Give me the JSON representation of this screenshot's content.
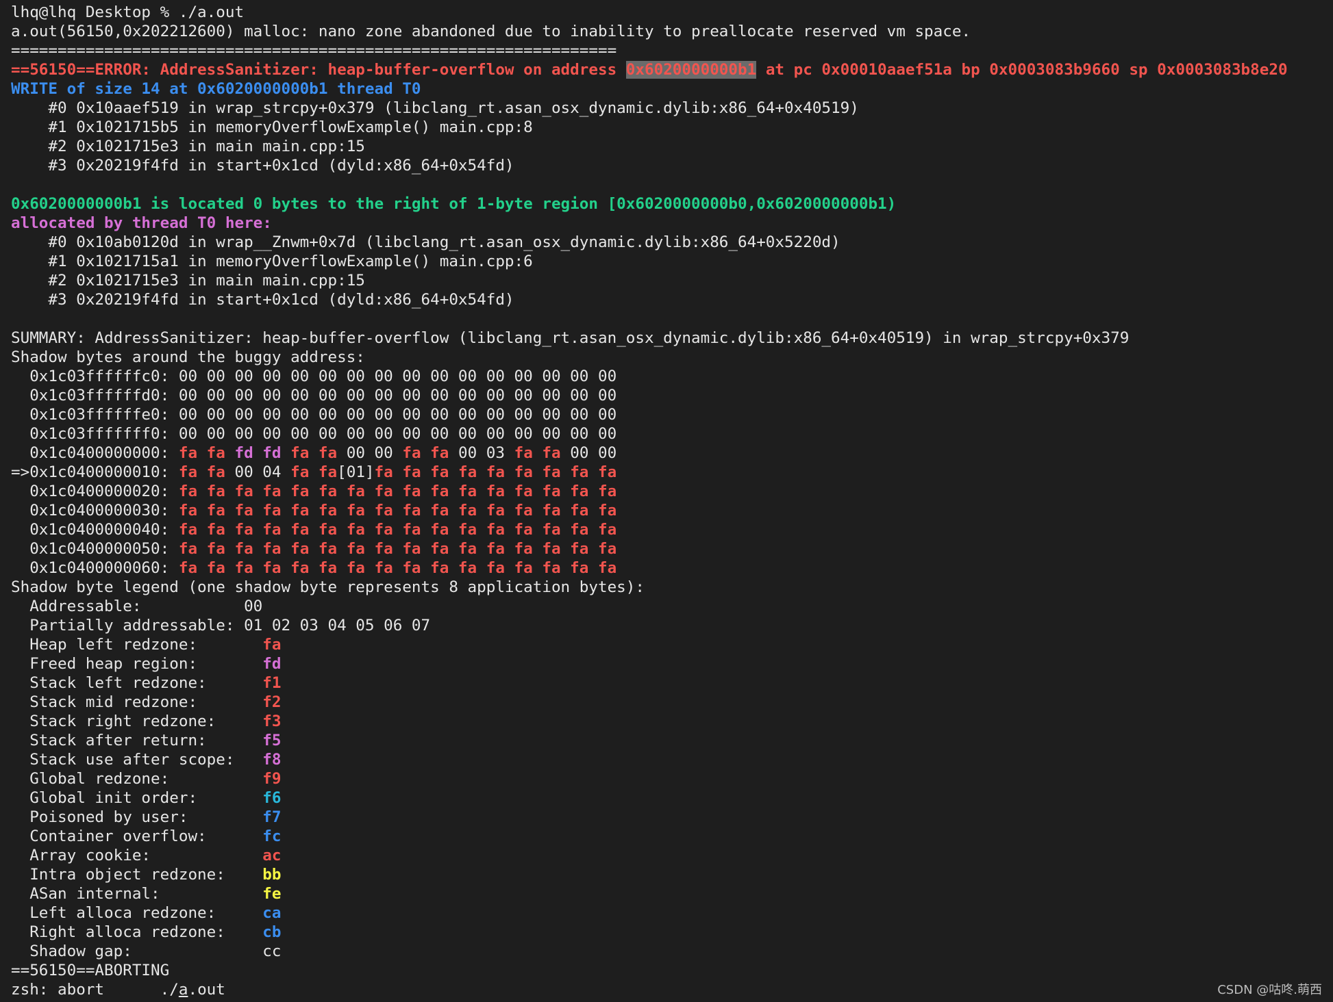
{
  "colors": {
    "background": "#1e1e1e",
    "text": "#e6e6e6",
    "red": "#f2554f",
    "blue": "#3b8ef0",
    "green": "#23d18b",
    "magenta": "#d670d6",
    "cyan": "#29b8db",
    "yellow": "#f5f543"
  },
  "watermark": "CSDN @咕咚.萌西",
  "lines": [
    [
      {
        "t": "lhq@lhq Desktop % ./a.out",
        "c": "plain"
      }
    ],
    [
      {
        "t": "a.out(56150,0x202212600) malloc: nano zone abandoned due to inability to preallocate reserved vm space.",
        "c": "plain"
      }
    ],
    [
      {
        "t": "=================================================================",
        "c": "plain"
      }
    ],
    [
      {
        "t": "==56150==ERROR: AddressSanitizer: heap-buffer-overflow on address ",
        "c": "red"
      },
      {
        "t": "0x6020000000b1",
        "c": "red hl"
      },
      {
        "t": " at pc 0x00010aaef51a bp 0x0003083b9660 sp 0x0003083b8e20",
        "c": "red"
      }
    ],
    [
      {
        "t": "WRITE of size 14 at 0x6020000000b1 thread T0",
        "c": "blue"
      }
    ],
    [
      {
        "t": "    #0 0x10aaef519 in wrap_strcpy+0x379 (libclang_rt.asan_osx_dynamic.dylib:x86_64+0x40519)",
        "c": "plain"
      }
    ],
    [
      {
        "t": "    #1 0x1021715b5 in memoryOverflowExample() main.cpp:8",
        "c": "plain"
      }
    ],
    [
      {
        "t": "    #2 0x1021715e3 in main main.cpp:15",
        "c": "plain"
      }
    ],
    [
      {
        "t": "    #3 0x20219f4fd in start+0x1cd (dyld:x86_64+0x54fd)",
        "c": "plain"
      }
    ],
    [
      {
        "t": "",
        "c": "plain"
      }
    ],
    [
      {
        "t": "0x6020000000b1 is located 0 bytes to the right of 1-byte region [0x6020000000b0,0x6020000000b1)",
        "c": "green"
      }
    ],
    [
      {
        "t": "allocated by thread T0 here:",
        "c": "magenta"
      }
    ],
    [
      {
        "t": "    #0 0x10ab0120d in wrap__Znwm+0x7d (libclang_rt.asan_osx_dynamic.dylib:x86_64+0x5220d)",
        "c": "plain"
      }
    ],
    [
      {
        "t": "    #1 0x1021715a1 in memoryOverflowExample() main.cpp:6",
        "c": "plain"
      }
    ],
    [
      {
        "t": "    #2 0x1021715e3 in main main.cpp:15",
        "c": "plain"
      }
    ],
    [
      {
        "t": "    #3 0x20219f4fd in start+0x1cd (dyld:x86_64+0x54fd)",
        "c": "plain"
      }
    ],
    [
      {
        "t": "",
        "c": "plain"
      }
    ],
    [
      {
        "t": "SUMMARY: AddressSanitizer: heap-buffer-overflow (libclang_rt.asan_osx_dynamic.dylib:x86_64+0x40519) in wrap_strcpy+0x379",
        "c": "plain"
      }
    ],
    [
      {
        "t": "Shadow bytes around the buggy address:",
        "c": "plain"
      }
    ],
    [
      {
        "t": "  0x1c03ffffffc0: 00 00 00 00 00 00 00 00 00 00 00 00 00 00 00 00",
        "c": "plain"
      }
    ],
    [
      {
        "t": "  0x1c03ffffffd0: 00 00 00 00 00 00 00 00 00 00 00 00 00 00 00 00",
        "c": "plain"
      }
    ],
    [
      {
        "t": "  0x1c03ffffffe0: 00 00 00 00 00 00 00 00 00 00 00 00 00 00 00 00",
        "c": "plain"
      }
    ],
    [
      {
        "t": "  0x1c03fffffff0: 00 00 00 00 00 00 00 00 00 00 00 00 00 00 00 00",
        "c": "plain"
      }
    ],
    [
      {
        "t": "  0x1c0400000000: ",
        "c": "plain"
      },
      {
        "t": "fa fa ",
        "c": "red"
      },
      {
        "t": "fd fd ",
        "c": "magenta"
      },
      {
        "t": "fa fa ",
        "c": "red"
      },
      {
        "t": "00 00 ",
        "c": "plain"
      },
      {
        "t": "fa fa ",
        "c": "red"
      },
      {
        "t": "00 03 ",
        "c": "plain"
      },
      {
        "t": "fa fa ",
        "c": "red"
      },
      {
        "t": "00 00",
        "c": "plain"
      }
    ],
    [
      {
        "t": "=>0x1c0400000010: ",
        "c": "plain"
      },
      {
        "t": "fa fa ",
        "c": "red"
      },
      {
        "t": "00 04 ",
        "c": "plain"
      },
      {
        "t": "fa fa",
        "c": "red"
      },
      {
        "t": "[01]",
        "c": "plain"
      },
      {
        "t": "fa fa fa fa fa fa fa fa fa",
        "c": "red"
      }
    ],
    [
      {
        "t": "  0x1c0400000020: ",
        "c": "plain"
      },
      {
        "t": "fa fa fa fa fa fa fa fa fa fa fa fa fa fa fa fa",
        "c": "red"
      }
    ],
    [
      {
        "t": "  0x1c0400000030: ",
        "c": "plain"
      },
      {
        "t": "fa fa fa fa fa fa fa fa fa fa fa fa fa fa fa fa",
        "c": "red"
      }
    ],
    [
      {
        "t": "  0x1c0400000040: ",
        "c": "plain"
      },
      {
        "t": "fa fa fa fa fa fa fa fa fa fa fa fa fa fa fa fa",
        "c": "red"
      }
    ],
    [
      {
        "t": "  0x1c0400000050: ",
        "c": "plain"
      },
      {
        "t": "fa fa fa fa fa fa fa fa fa fa fa fa fa fa fa fa",
        "c": "red"
      }
    ],
    [
      {
        "t": "  0x1c0400000060: ",
        "c": "plain"
      },
      {
        "t": "fa fa fa fa fa fa fa fa fa fa fa fa fa fa fa fa",
        "c": "red"
      }
    ],
    [
      {
        "t": "Shadow byte legend (one shadow byte represents 8 application bytes):",
        "c": "plain"
      }
    ],
    [
      {
        "t": "  Addressable:           00",
        "c": "plain"
      }
    ],
    [
      {
        "t": "  Partially addressable: 01 02 03 04 05 06 07",
        "c": "plain"
      }
    ],
    [
      {
        "t": "  Heap left redzone:       ",
        "c": "plain"
      },
      {
        "t": "fa",
        "c": "red"
      }
    ],
    [
      {
        "t": "  Freed heap region:       ",
        "c": "plain"
      },
      {
        "t": "fd",
        "c": "magenta"
      }
    ],
    [
      {
        "t": "  Stack left redzone:      ",
        "c": "plain"
      },
      {
        "t": "f1",
        "c": "red"
      }
    ],
    [
      {
        "t": "  Stack mid redzone:       ",
        "c": "plain"
      },
      {
        "t": "f2",
        "c": "red"
      }
    ],
    [
      {
        "t": "  Stack right redzone:     ",
        "c": "plain"
      },
      {
        "t": "f3",
        "c": "red"
      }
    ],
    [
      {
        "t": "  Stack after return:      ",
        "c": "plain"
      },
      {
        "t": "f5",
        "c": "magenta"
      }
    ],
    [
      {
        "t": "  Stack use after scope:   ",
        "c": "plain"
      },
      {
        "t": "f8",
        "c": "magenta"
      }
    ],
    [
      {
        "t": "  Global redzone:          ",
        "c": "plain"
      },
      {
        "t": "f9",
        "c": "red"
      }
    ],
    [
      {
        "t": "  Global init order:       ",
        "c": "plain"
      },
      {
        "t": "f6",
        "c": "cyan"
      }
    ],
    [
      {
        "t": "  Poisoned by user:        ",
        "c": "plain"
      },
      {
        "t": "f7",
        "c": "blue"
      }
    ],
    [
      {
        "t": "  Container overflow:      ",
        "c": "plain"
      },
      {
        "t": "fc",
        "c": "blue"
      }
    ],
    [
      {
        "t": "  Array cookie:            ",
        "c": "plain"
      },
      {
        "t": "ac",
        "c": "red"
      }
    ],
    [
      {
        "t": "  Intra object redzone:    ",
        "c": "plain"
      },
      {
        "t": "bb",
        "c": "yellow"
      }
    ],
    [
      {
        "t": "  ASan internal:           ",
        "c": "plain"
      },
      {
        "t": "fe",
        "c": "yellow"
      }
    ],
    [
      {
        "t": "  Left alloca redzone:     ",
        "c": "plain"
      },
      {
        "t": "ca",
        "c": "blue"
      }
    ],
    [
      {
        "t": "  Right alloca redzone:    ",
        "c": "plain"
      },
      {
        "t": "cb",
        "c": "blue"
      }
    ],
    [
      {
        "t": "  Shadow gap:              cc",
        "c": "plain"
      }
    ],
    [
      {
        "t": "==56150==ABORTING",
        "c": "plain"
      }
    ],
    [
      {
        "t": "zsh: abort      ./",
        "c": "plain"
      },
      {
        "t": "a",
        "c": "plain cursor"
      },
      {
        "t": ".out",
        "c": "plain"
      }
    ]
  ]
}
